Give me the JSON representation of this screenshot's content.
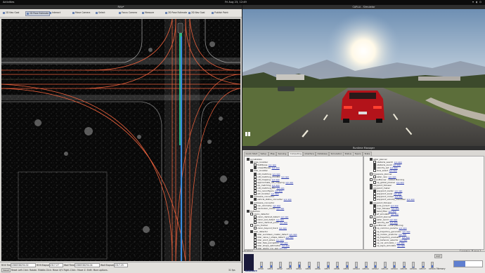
{
  "topbar": {
    "activities": "Activities",
    "clock": "Fri Aug 23, 12:49",
    "tray": "▾ ◖ ⏻"
  },
  "rviz": {
    "title": "RViz*",
    "toolbar": [
      "2D Nav Goal",
      "2D Pose Estimate",
      "Interact",
      "Move Camera",
      "Select",
      "Focus Camera",
      "Measure",
      "2D Pose Estimate",
      "2D Nav Goal",
      "Publish Point"
    ],
    "status": {
      "ros_time_label": "ROS Time:",
      "ros_time": "1566538294.02",
      "ros_elapsed_label": "ROS Elapsed:",
      "ros_elapsed": "2317.27",
      "wall_time_label": "Wall Time:",
      "wall_time": "1566538294.04",
      "wall_elapsed_label": "Wall Elapsed:",
      "wall_elapsed": "2317.25",
      "reset": "Reset",
      "hint": "Reset   Left-Click: Rotate.  Middle-Click: Move X/Y.  Right-Click:: Move Z.  Shift: More options.",
      "fps": "31 fps"
    }
  },
  "carla": {
    "title": "CARLA - Simulator",
    "play_icon": "pause-icon"
  },
  "awm": {
    "title": "Runtime Manager",
    "tabs": [
      "Quick Start",
      "Setup",
      "Map",
      "Sensing",
      "Computing",
      "Interface",
      "Database",
      "Simulation",
      "Status",
      "Topics",
      "State"
    ],
    "left_nodes": [
      {
        "t": "Localization",
        "d": 0,
        "c": true
      },
      {
        "t": "gnss_localizer",
        "d": 1,
        "c": true
      },
      {
        "t": "fix2tfpose",
        "d": 2,
        "c": false,
        "a": "sys app"
      },
      {
        "t": "nmea2tfpose",
        "d": 2,
        "c": true,
        "a": "sys app"
      },
      {
        "t": "lidar_localizer",
        "d": 1,
        "c": true
      },
      {
        "t": "ndt_matching",
        "d": 2,
        "c": true,
        "a": "sys app"
      },
      {
        "t": "ndt_matching_monitor",
        "d": 2,
        "c": false,
        "a": "sys app"
      },
      {
        "t": "ndt_mapping",
        "d": 2,
        "c": false,
        "a": "sys app"
      },
      {
        "t": "approximate_ndt_mapping",
        "d": 2,
        "c": false,
        "a": "sys app"
      },
      {
        "t": "icp_matching",
        "d": 2,
        "c": false,
        "a": "sys app"
      },
      {
        "t": "ndt_matching_tku",
        "d": 2,
        "c": false,
        "a": "sys app"
      },
      {
        "t": "imu_reconfigure",
        "d": 2,
        "c": false,
        "a": "sys app"
      },
      {
        "t": "ekf_localizer",
        "d": 2,
        "c": false,
        "a": "sys app"
      },
      {
        "t": "autoware_connector",
        "d": 1,
        "c": true
      },
      {
        "t": "vehicle_status_converter",
        "d": 2,
        "c": true,
        "a": "sys app"
      },
      {
        "t": "autoware_connector",
        "d": 1,
        "c": true
      },
      {
        "t": "can_odometry",
        "d": 2,
        "c": false,
        "a": "sys app"
      },
      {
        "t": "can2odom_model",
        "d": 2,
        "c": false,
        "a": "sys app"
      },
      {
        "t": "Detection",
        "d": 0,
        "c": true
      },
      {
        "t": "vision_detector",
        "d": 1,
        "c": false
      },
      {
        "t": "vision_darknet_detect",
        "d": 2,
        "c": false,
        "a": "sys app"
      },
      {
        "t": "vision_ssd_detect",
        "d": 2,
        "c": false,
        "a": "sys app"
      },
      {
        "t": "vision_darknet_yolo3",
        "d": 2,
        "c": false,
        "a": "sys app"
      },
      {
        "t": "vision_tracker",
        "d": 1,
        "c": false
      },
      {
        "t": "vision_beyond_track",
        "d": 2,
        "c": false,
        "a": "sys app"
      },
      {
        "t": "lidar_detector",
        "d": 1,
        "c": true
      },
      {
        "t": "lidar_euclidean_cluster_detect",
        "d": 2,
        "c": true,
        "a": "sys app"
      },
      {
        "t": "lidar_naive_l_shape_detect",
        "d": 2,
        "c": false,
        "a": "sys app"
      },
      {
        "t": "lidar_point_pillars",
        "d": 2,
        "c": false,
        "a": "sys app"
      },
      {
        "t": "lidar_fake_perception",
        "d": 2,
        "c": false,
        "a": "sys app"
      },
      {
        "t": "lidar_shape_estimation",
        "d": 2,
        "c": false,
        "a": "sys app"
      },
      {
        "t": "lidar_apollo_cnn_seg",
        "d": 2,
        "c": false,
        "a": "sys app"
      }
    ],
    "right_nodes": [
      {
        "t": "astar_planner",
        "d": 1,
        "c": true
      },
      {
        "t": "obstacle_search",
        "d": 2,
        "c": false,
        "a": "sys app"
      },
      {
        "t": "obstacle_avoid",
        "d": 2,
        "c": true,
        "a": "sys app"
      },
      {
        "t": "velocity_set",
        "d": 2,
        "c": true,
        "a": "sys app"
      },
      {
        "t": "lane_select",
        "d": 2,
        "c": false,
        "a": "sys app"
      },
      {
        "t": "freespace_planner",
        "d": 1,
        "c": false
      },
      {
        "t": "astar_navi",
        "d": 2,
        "c": false,
        "a": "sys app"
      },
      {
        "t": "OpenPlanner - Global Planning",
        "d": 1,
        "c": false
      },
      {
        "t": "op_global_planner",
        "d": 2,
        "c": false,
        "a": "sys app"
      },
      {
        "t": "waypoint_follower",
        "d": 1,
        "c": true
      },
      {
        "t": "waypoint_maker",
        "d": 1,
        "c": true
      },
      {
        "t": "waypoint_loader",
        "d": 2,
        "c": true,
        "a": "sys app"
      },
      {
        "t": "waypoint_saver",
        "d": 2,
        "c": false,
        "a": "sys app"
      },
      {
        "t": "waypoint_clicker",
        "d": 2,
        "c": false,
        "a": "sys app"
      },
      {
        "t": "waypoint_velocity_visualizer",
        "d": 2,
        "c": false,
        "a": "sys app"
      },
      {
        "t": "waypoint_follower",
        "d": 1,
        "c": true
      },
      {
        "t": "pure_pursuit",
        "d": 2,
        "c": true,
        "a": "sys app"
      },
      {
        "t": "mpc_follower",
        "d": 2,
        "c": false,
        "a": "sys app"
      },
      {
        "t": "twist_filter",
        "d": 2,
        "c": true,
        "a": "sys app"
      },
      {
        "t": "wf_simulator",
        "d": 2,
        "c": false,
        "a": "sys app"
      },
      {
        "t": "waypoint_planner",
        "d": 1,
        "c": false
      },
      {
        "t": "astar_avoid",
        "d": 2,
        "c": false,
        "a": "sys app"
      },
      {
        "t": "velocity_set",
        "d": 2,
        "c": false,
        "a": "sys app"
      },
      {
        "t": "OpenPlanner - Local planning",
        "d": 1,
        "c": false
      },
      {
        "t": "op_common_params",
        "d": 2,
        "c": false,
        "a": "sys app"
      },
      {
        "t": "op_trajectory_generator",
        "d": 2,
        "c": false,
        "a": "sys app"
      },
      {
        "t": "op_motion_predictor",
        "d": 2,
        "c": false,
        "a": "sys app"
      },
      {
        "t": "op_trajectory_evaluator",
        "d": 2,
        "c": false,
        "a": "sys app"
      },
      {
        "t": "op_behavior_selector",
        "d": 2,
        "c": false,
        "a": "sys app"
      },
      {
        "t": "op_car_simulator_i",
        "d": 2,
        "c": false,
        "a": "sys app"
      },
      {
        "t": "op_signs_simulator",
        "d": 2,
        "c": false,
        "a": "sys app"
      }
    ],
    "rosbag": "ROSBAG",
    "buttons": [
      "ROSBAG",
      "RVIZ",
      "RQT"
    ],
    "mem_label": "Memory",
    "logo": "Autoware",
    "cpus": [
      "CPU0",
      "CPU1",
      "CPU2",
      "CPU3",
      "CPU4",
      "CPU5",
      "CPU6",
      "CPU7",
      "CPU8",
      "CPU9",
      "CPU10",
      "CPU11",
      "CPU12",
      "CPU13",
      "CPU14",
      "CPU15",
      "CPU16",
      "CPU17",
      "CPU18"
    ],
    "cpu_load": [
      0.3,
      0.5,
      0.2,
      0.4,
      0.6,
      0.3,
      0.2,
      0.5,
      0.3,
      0.4,
      0.2,
      0.3,
      0.5,
      0.2,
      0.4,
      0.3,
      0.2,
      0.3,
      0.4
    ],
    "colors": {
      "route": "#e8603c",
      "path": "#3a8be0",
      "lane": "#2fd08c"
    }
  }
}
